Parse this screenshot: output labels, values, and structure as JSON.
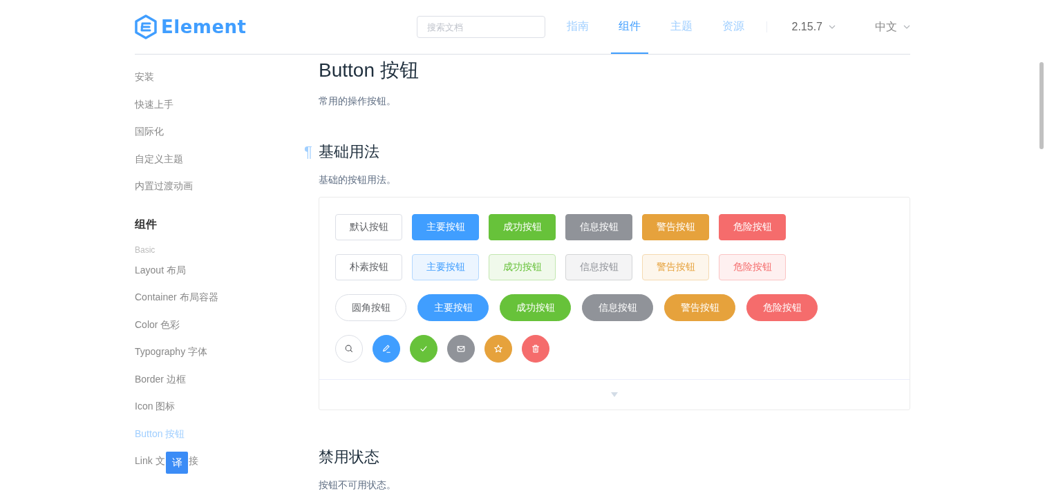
{
  "header": {
    "logo_text": "Element",
    "search": {
      "placeholder": "搜索文档"
    },
    "nav": [
      {
        "label": "指南",
        "selected": false
      },
      {
        "label": "组件",
        "selected": true
      },
      {
        "label": "主题",
        "selected": false
      },
      {
        "label": "资源",
        "selected": false
      }
    ],
    "version": "2.15.7",
    "language": "中文"
  },
  "sidebar": {
    "top_items": [
      {
        "label": "安装",
        "selected": false
      },
      {
        "label": "快速上手",
        "selected": false
      },
      {
        "label": "国际化",
        "selected": false
      },
      {
        "label": "自定义主题",
        "selected": false
      },
      {
        "label": "内置过渡动画",
        "selected": false
      }
    ],
    "group_title": "组件",
    "category": "Basic",
    "items": [
      {
        "label": "Layout 布局",
        "selected": false
      },
      {
        "label": "Container 布局容器",
        "selected": false
      },
      {
        "label": "Color 色彩",
        "selected": false
      },
      {
        "label": "Typography 字体",
        "selected": false
      },
      {
        "label": "Border 边框",
        "selected": false
      },
      {
        "label": "Icon 图标",
        "selected": false
      },
      {
        "label": "Button 按钮",
        "selected": true
      },
      {
        "label": "Link 文",
        "hidden_tail": "接",
        "selected": false
      }
    ]
  },
  "translate_badge": "译",
  "page": {
    "title": "Button 按钮",
    "subtitle": "常用的操作按钮。",
    "sections": [
      {
        "anchor": "¶",
        "title": "基础用法",
        "description": "基础的按钮用法。",
        "rows": [
          {
            "kind": "default",
            "buttons": [
              {
                "label": "默认按钮",
                "kind": "default"
              },
              {
                "label": "主要按钮",
                "kind": "primary"
              },
              {
                "label": "成功按钮",
                "kind": "success"
              },
              {
                "label": "信息按钮",
                "kind": "info"
              },
              {
                "label": "警告按钮",
                "kind": "warning"
              },
              {
                "label": "危险按钮",
                "kind": "danger"
              }
            ]
          },
          {
            "kind": "plain",
            "buttons": [
              {
                "label": "朴素按钮",
                "kind": "default"
              },
              {
                "label": "主要按钮",
                "kind": "primary"
              },
              {
                "label": "成功按钮",
                "kind": "success"
              },
              {
                "label": "信息按钮",
                "kind": "info"
              },
              {
                "label": "警告按钮",
                "kind": "warning"
              },
              {
                "label": "危险按钮",
                "kind": "danger"
              }
            ]
          },
          {
            "kind": "round",
            "buttons": [
              {
                "label": "圆角按钮",
                "kind": "default"
              },
              {
                "label": "主要按钮",
                "kind": "primary"
              },
              {
                "label": "成功按钮",
                "kind": "success"
              },
              {
                "label": "信息按钮",
                "kind": "info"
              },
              {
                "label": "警告按钮",
                "kind": "warning"
              },
              {
                "label": "危险按钮",
                "kind": "danger"
              }
            ]
          },
          {
            "kind": "circle",
            "buttons": [
              {
                "kind": "default"
              },
              {
                "kind": "primary"
              },
              {
                "kind": "success"
              },
              {
                "kind": "info"
              },
              {
                "kind": "warning"
              },
              {
                "kind": "danger"
              }
            ]
          }
        ]
      },
      {
        "title": "禁用状态",
        "description": "按钮不可用状态。"
      }
    ]
  }
}
